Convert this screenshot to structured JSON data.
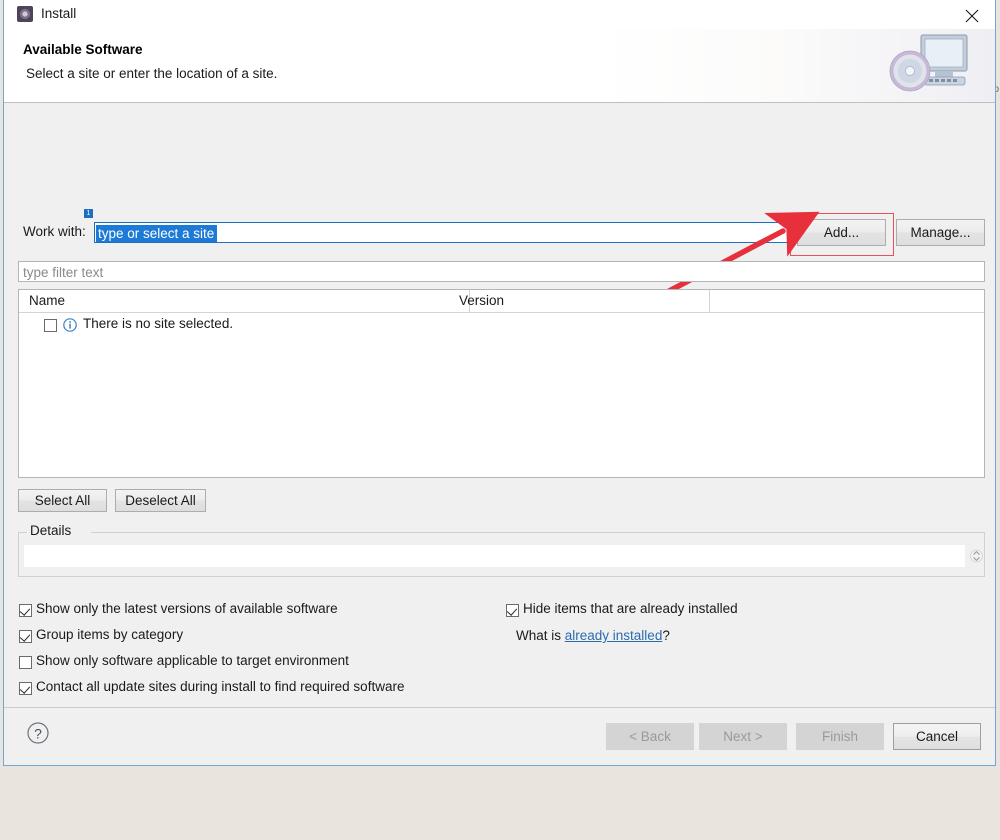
{
  "window": {
    "title": "Install",
    "title_icon": "install-gear-icon",
    "close_icon": "close-icon"
  },
  "header": {
    "title": "Available Software",
    "subtitle": "Select a site or enter the location of a site.",
    "banner_icon": "monitor-with-disc-icon"
  },
  "work_with": {
    "label": "Work with:",
    "badge": "1",
    "value": "type or select a site",
    "add_label": "Add...",
    "manage_label": "Manage..."
  },
  "filter": {
    "placeholder": "type filter text",
    "value": ""
  },
  "table": {
    "columns": [
      "Name",
      "Version",
      ""
    ],
    "rows": [
      {
        "checked": false,
        "icon": "info-icon",
        "name": "There is no site selected.",
        "version": ""
      }
    ]
  },
  "selection_buttons": {
    "select_all": "Select All",
    "deselect_all": "Deselect All"
  },
  "details": {
    "legend": "Details",
    "text": "",
    "spinner_icon": "spinner-up-down-icon"
  },
  "options": {
    "left": [
      {
        "label": "Show only the latest versions of available software",
        "checked": true
      },
      {
        "label": "Group items by category",
        "checked": true
      },
      {
        "label": "Show only software applicable to target environment",
        "checked": false
      },
      {
        "label": "Contact all update sites during install to find required software",
        "checked": true
      }
    ],
    "right": [
      {
        "label": "Hide items that are already installed",
        "checked": true
      }
    ],
    "what_is_prefix": "What is ",
    "what_is_link": "already installed",
    "what_is_suffix": "?"
  },
  "footer": {
    "help_icon": "help-question-icon",
    "back": "< Back",
    "next": "Next >",
    "finish": "Finish",
    "cancel": "Cancel"
  },
  "annotation": {
    "arrow_color": "#e8303c",
    "box_color": "#e8505b",
    "points_at": "Add..."
  },
  "colors": {
    "accent_blue": "#1d7ad6",
    "link_blue": "#2b6cb0",
    "window_border": "#6ea8d8"
  }
}
